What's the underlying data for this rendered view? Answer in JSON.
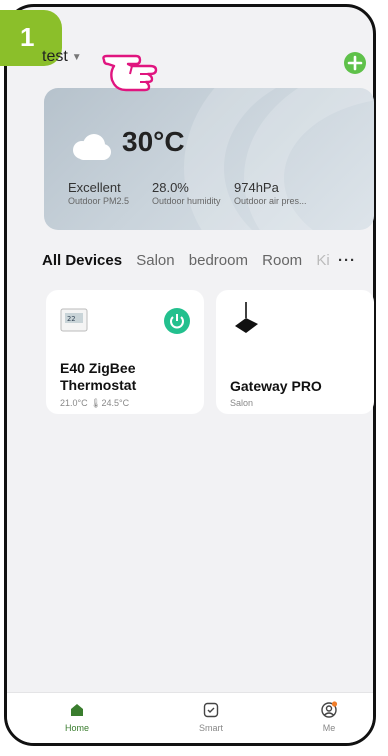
{
  "step_number": "1",
  "header": {
    "home_name": "test",
    "caret": "▼",
    "add_icon": "plus-icon"
  },
  "weather": {
    "temperature": "30°C",
    "icon": "cloud-icon",
    "metrics": [
      {
        "value": "Excellent",
        "label": "Outdoor PM2.5"
      },
      {
        "value": "28.0%",
        "label": "Outdoor humidity"
      },
      {
        "value": "974hPa",
        "label": "Outdoor air pres..."
      }
    ]
  },
  "tabs": {
    "items": [
      "All Devices",
      "Salon",
      "bedroom",
      "Room",
      "Ki"
    ],
    "active": "All Devices",
    "more": "···"
  },
  "devices": [
    {
      "name_line1": "E40 ZigBee",
      "name_line2": "Thermostat",
      "sub": "21.0°C  🌡24.5°C",
      "icon": "thermostat-icon"
    },
    {
      "name_line1": "Gateway PRO",
      "sub": "Salon",
      "icon": "gateway-icon"
    }
  ],
  "bottom_nav": [
    {
      "label": "Home",
      "icon": "home-icon"
    },
    {
      "label": "Smart",
      "icon": "smart-icon"
    },
    {
      "label": "Me",
      "icon": "user-icon"
    }
  ],
  "colors": {
    "accent": "#3a7d2e",
    "power": "#23c08e",
    "add": "#5fc14a",
    "step": "#8bbf2a",
    "hand": "#e0157f"
  }
}
